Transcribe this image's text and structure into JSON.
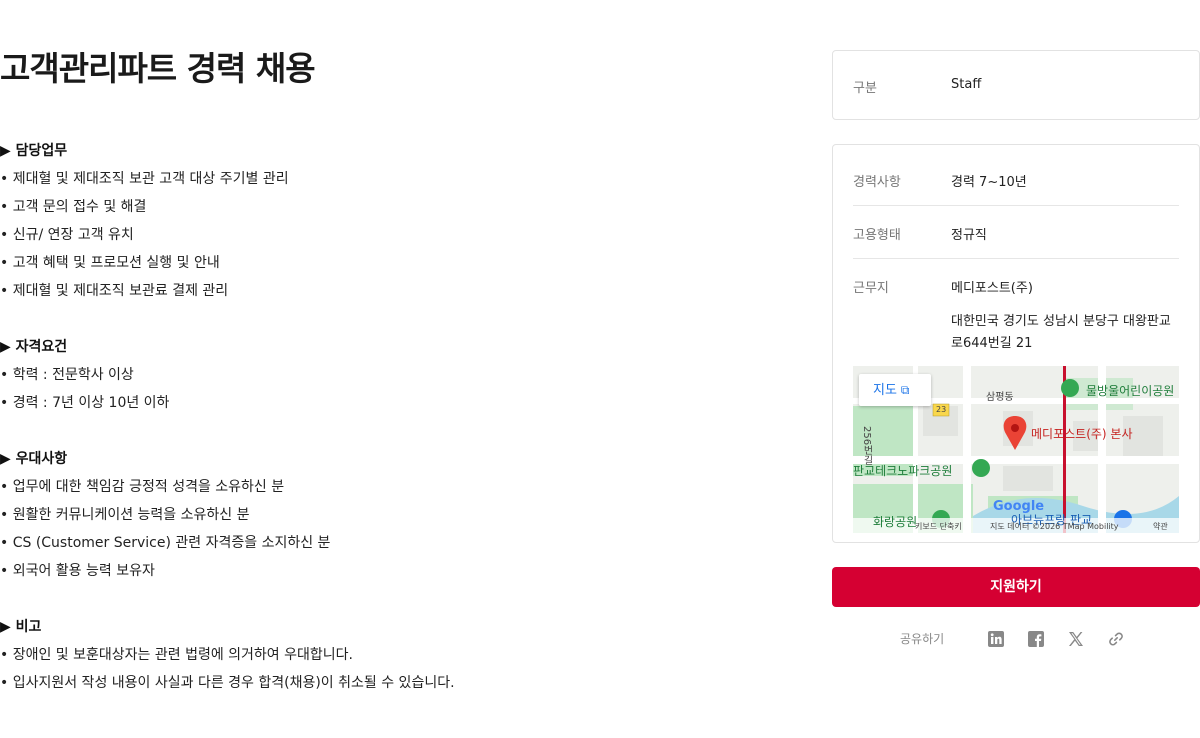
{
  "title": "고객관리파트 경력 채용",
  "sections": [
    {
      "heading": "▶ 담당업무",
      "items": [
        "• 제대혈 및 제대조직 보관 고객 대상 주기별 관리",
        "• 고객 문의 접수 및 해결",
        "• 신규/ 연장 고객 유치",
        "• 고객 혜택 및 프로모션 실행 및 안내",
        "• 제대혈 및 제대조직 보관료 결제 관리"
      ]
    },
    {
      "heading": "▶ 자격요건",
      "items": [
        "• 학력 : 전문학사 이상",
        "• 경력 : 7년 이상 10년 이하"
      ]
    },
    {
      "heading": "▶ 우대사항",
      "items": [
        "• 업무에 대한 책임감 긍정적 성격을 소유하신 분",
        "• 원활한 커뮤니케이션 능력을 소유하신 분",
        "• CS (Customer Service) 관련 자격증을 소지하신 분",
        "• 외국어 활용 능력 보유자"
      ]
    },
    {
      "heading": "▶ 비고",
      "items": [
        "• 장애인 및 보훈대상자는 관련 법령에 의거하여 우대합니다.",
        "• 입사지원서 작성 내용이 사실과 다른 경우 합격(채용)이 취소될 수 있습니다."
      ]
    }
  ],
  "info": {
    "category_label": "구분",
    "category_value": "Staff",
    "career_label": "경력사항",
    "career_value": "경력 7~10년",
    "employment_label": "고용형태",
    "employment_value": "정규직",
    "location_label": "근무지",
    "company": "메디포스트(주)",
    "address_line1": "대한민국 경기도 성남시 분당구 대왕판교",
    "address_line2": "로644번길 21"
  },
  "map": {
    "button_label": "지도",
    "marker_label": "메디포스트(주) 본사",
    "labels": {
      "district": "삼평동",
      "park_top": "물방울어린이공원",
      "park_left": "판교테크노파크공원",
      "park_bottom": "화랑공원",
      "park_bottom_right": "아브뉴프랑 판교",
      "road_vertical": "256번길",
      "route": "23",
      "logo": "Google"
    },
    "footer": {
      "shortcuts": "키보드 단축키",
      "attribution": "지도 데이터 ©2026 TMap Mobility",
      "terms": "약관"
    },
    "colors": {
      "road_major": "#c8102e",
      "park": "#bfe6c4",
      "marker": "#ea4335",
      "pin_green": "#34a853"
    }
  },
  "apply_button": "지원하기",
  "share": {
    "label": "공유하기",
    "icons": [
      "linkedin-icon",
      "facebook-icon",
      "x-icon",
      "link-icon"
    ]
  },
  "colors": {
    "accent": "#d50032"
  }
}
